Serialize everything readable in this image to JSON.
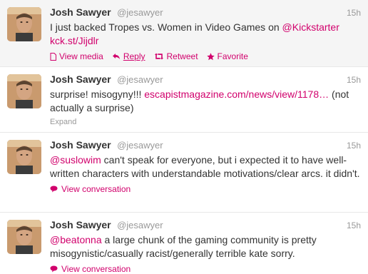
{
  "colors": {
    "accent": "#d1006c",
    "muted": "#999999",
    "text": "#333333",
    "highlight_bg": "#f5f5f5"
  },
  "tweets": [
    {
      "fullname": "Josh Sawyer",
      "username": "@jesawyer",
      "time": "15h",
      "text_parts": {
        "t1": "I just backed Tropes vs. Women in Video Games on ",
        "l1": "@Kickstarter",
        "t2": " ",
        "l2": "kck.st/Jijdlr"
      },
      "actions": {
        "view_media": "View media",
        "reply": "Reply",
        "retweet": "Retweet",
        "favorite": "Favorite"
      }
    },
    {
      "fullname": "Josh Sawyer",
      "username": "@jesawyer",
      "time": "15h",
      "text_parts": {
        "t1": "surprise! misogyny!!! ",
        "l1": "escapistmagazine.com/news/view/1178…",
        "t2": " (not actually a surprise)"
      },
      "expand": "Expand"
    },
    {
      "fullname": "Josh Sawyer",
      "username": "@jesawyer",
      "time": "15h",
      "text_parts": {
        "l1": "@suslowim",
        "t1": " can't speak for everyone, but i expected it to have well-written characters with understandable motivations/clear arcs. it didn't."
      },
      "view_conversation": "View conversation"
    },
    {
      "fullname": "Josh Sawyer",
      "username": "@jesawyer",
      "time": "15h",
      "text_parts": {
        "l1": "@beatonna",
        "t1": " a large chunk of the gaming community is pretty misogynistic/casually racist/generally terrible kate sorry."
      },
      "view_conversation": "View conversation"
    }
  ]
}
